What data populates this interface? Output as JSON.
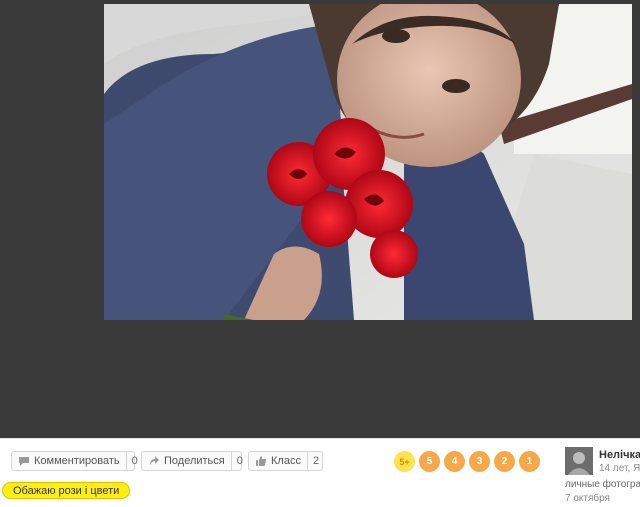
{
  "actions": {
    "comment": {
      "label": "Комментировать",
      "count": "0"
    },
    "share": {
      "label": "Поделиться",
      "count": "0"
    },
    "like": {
      "label": "Класс",
      "count": "2"
    }
  },
  "rating": {
    "items": [
      "5+",
      "5",
      "4",
      "3",
      "2",
      "1"
    ]
  },
  "photo": {
    "caption": "Обажаю рози і цвети"
  },
  "author": {
    "name": "Нелічка",
    "info": "14 лет, Я"
  },
  "album": {
    "label": "личные фотогра"
  },
  "date": {
    "label": "7 октября"
  },
  "colors": {
    "accent": "#f7a94a",
    "caption_bg": "#ffee11",
    "viewer_bg": "#3a3a3a"
  },
  "icons": {
    "comment": "speech-bubble-icon",
    "share": "share-arrow-icon",
    "like": "thumbs-up-icon"
  }
}
